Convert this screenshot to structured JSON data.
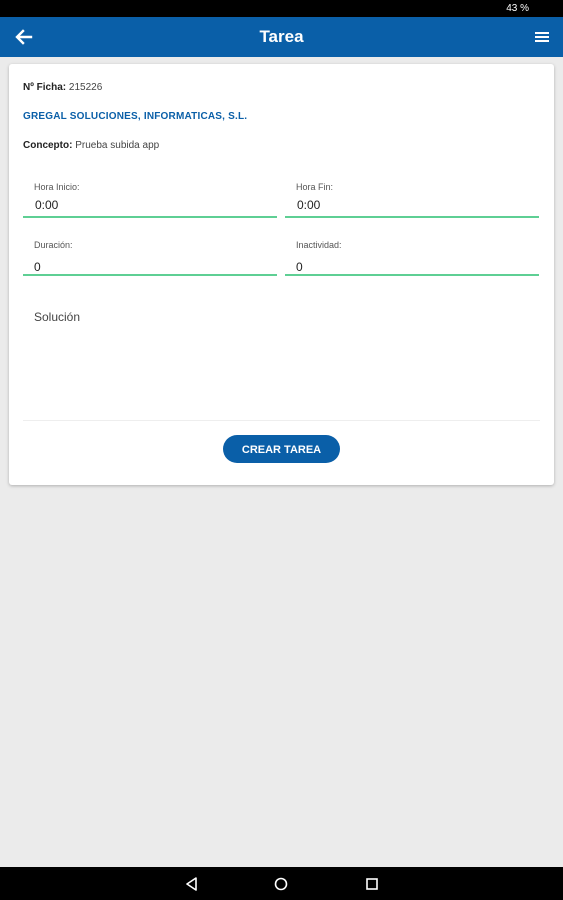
{
  "status_bar": {
    "battery": "43 %"
  },
  "app_bar": {
    "title": "Tarea",
    "icons": [
      "arrow-back-icon",
      "hamburger-menu-icon"
    ]
  },
  "ficha": {
    "label": "Nº Ficha:",
    "value": "215226"
  },
  "empresa": "GREGAL SOLUCIONES, INFORMATICAS, S.L.",
  "concepto": {
    "label": "Concepto:",
    "value": "Prueba subida app"
  },
  "fields": {
    "hora_inicio": {
      "label": "Hora Inicio:",
      "value": "0:00"
    },
    "hora_fin": {
      "label": "Hora Fin:",
      "value": "0:00"
    },
    "duracion": {
      "label": "Duración:",
      "value": "0"
    },
    "inactividad": {
      "label": "Inactividad:",
      "value": "0"
    }
  },
  "solucion": {
    "placeholder": "Solución"
  },
  "button": {
    "label": "CREAR TAREA"
  },
  "colors": {
    "primary": "#0a5fa8",
    "field_underline": "#5ecf94",
    "background": "#ebebeb"
  },
  "nav_bar": {
    "icons": [
      "triangle-back-icon",
      "circle-home-icon",
      "square-recents-icon"
    ]
  }
}
